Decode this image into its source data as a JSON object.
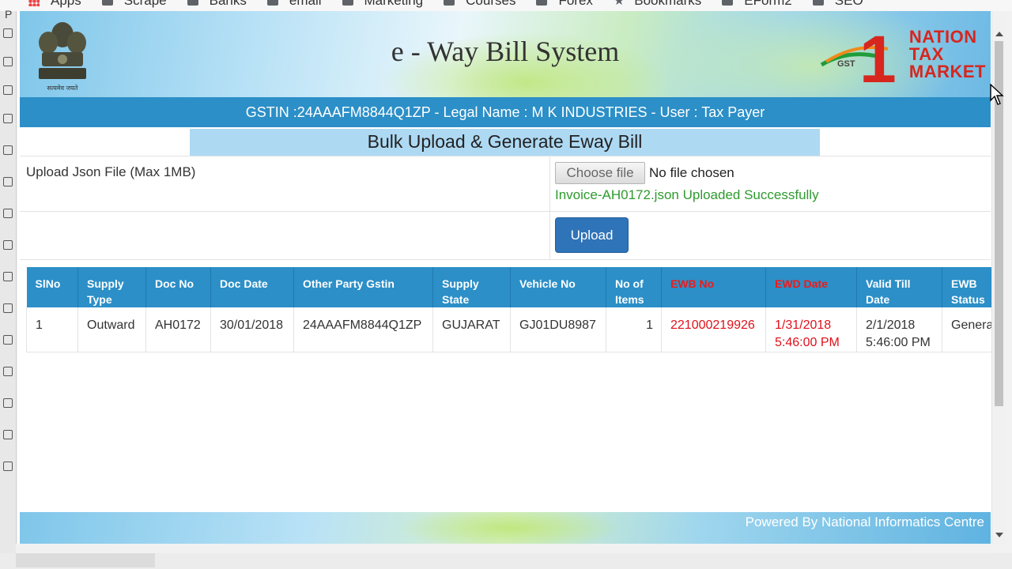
{
  "browser": {
    "bookmarks": [
      {
        "label": "Apps",
        "icon": "apps-icon"
      },
      {
        "label": "Scrape",
        "icon": "folder-icon"
      },
      {
        "label": "Banks",
        "icon": "folder-icon"
      },
      {
        "label": "email",
        "icon": "folder-icon"
      },
      {
        "label": "Marketing",
        "icon": "folder-icon"
      },
      {
        "label": "Courses",
        "icon": "folder-icon"
      },
      {
        "label": "Forex",
        "icon": "folder-icon"
      },
      {
        "label": "Bookmarks",
        "icon": "star-icon"
      },
      {
        "label": "EForm2",
        "icon": "folder-icon"
      },
      {
        "label": "SEO",
        "icon": "folder-icon"
      }
    ],
    "left_strip_char": "P"
  },
  "header": {
    "title": "e - Way Bill System",
    "emblem_text": "सत्यमेव जयते",
    "logo": {
      "line1": "NATION",
      "line2": "TAX",
      "line3": "MARKET",
      "number": "1",
      "gst": "GST"
    }
  },
  "gstin_bar": "GSTIN :24AAAFM8844Q1ZP - Legal Name : M K INDUSTRIES - User : Tax Payer",
  "section_title": "Bulk Upload & Generate Eway Bill",
  "upload": {
    "label": "Upload Json File (Max 1MB)",
    "choose_file_label": "Choose file",
    "no_file_text": "No file chosen",
    "success_message": "Invoice-AH0172.json Uploaded Successfully",
    "upload_button_label": "Upload"
  },
  "table": {
    "headers": [
      {
        "label": "SlNo",
        "color": "#ffffff"
      },
      {
        "label": "Supply Type",
        "color": "#ffffff"
      },
      {
        "label": "Doc No",
        "color": "#ffffff"
      },
      {
        "label": "Doc Date",
        "color": "#ffffff"
      },
      {
        "label": "Other Party Gstin",
        "color": "#ffffff"
      },
      {
        "label": "Supply State",
        "color": "#ffffff"
      },
      {
        "label": "Vehicle No",
        "color": "#ffffff"
      },
      {
        "label": "No of Items",
        "color": "#ffffff"
      },
      {
        "label": "EWB No",
        "color": "#ee1a1a"
      },
      {
        "label": "EWD Date",
        "color": "#ee1a1a"
      },
      {
        "label": "Valid Till Date",
        "color": "#ffffff"
      },
      {
        "label": "EWB Status",
        "color": "#ffffff"
      }
    ],
    "rows": [
      {
        "slno": "1",
        "supply_type": "Outward",
        "doc_no": "AH0172",
        "doc_date": "30/01/2018",
        "other_party_gstin": "24AAAFM8844Q1ZP",
        "supply_state": "GUJARAT",
        "vehicle_no": "GJ01DU8987",
        "no_of_items": "1",
        "ewb_no": "221000219926",
        "ewd_date_line1": "1/31/2018",
        "ewd_date_line2": "5:46:00 PM",
        "valid_till_line1": "2/1/2018",
        "valid_till_line2": "5:46:00 PM",
        "ewb_status": "Genera"
      }
    ]
  },
  "footer": "Powered By National Informatics Centre",
  "colors": {
    "header_bar": "#2c8fc7",
    "subtitle_bg": "#aed9f3",
    "success_green": "#2e9a2e",
    "button_blue": "#2f73b8",
    "alert_red": "#e0101a"
  }
}
